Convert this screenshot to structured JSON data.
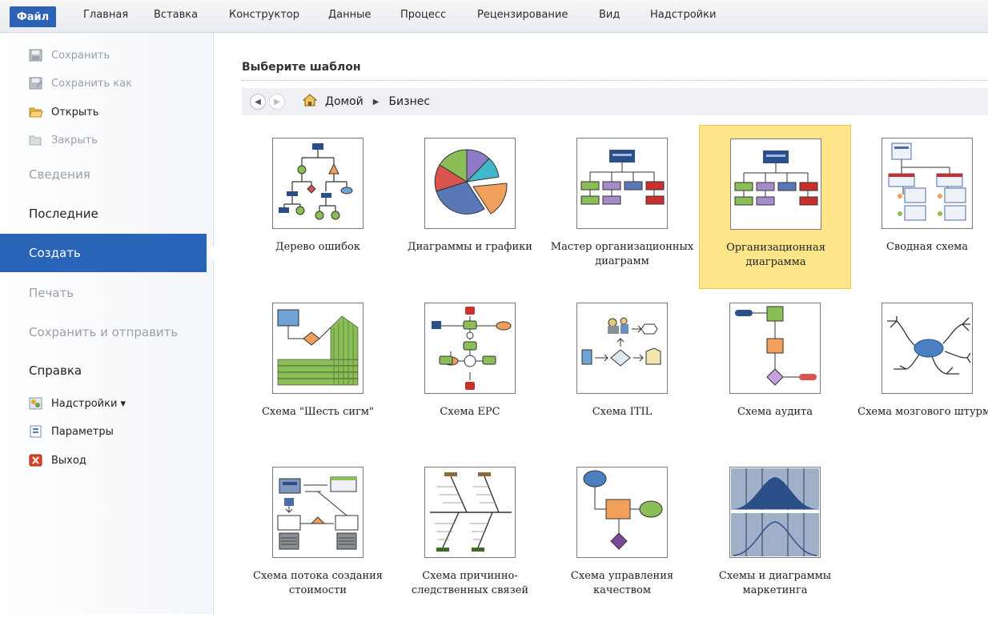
{
  "ribbon": {
    "tabs": [
      "Файл",
      "Главная",
      "Вставка",
      "Конструктор",
      "Данные",
      "Процесс",
      "Рецензирование",
      "Вид",
      "Надстройки"
    ]
  },
  "sidebar": {
    "save": "Сохранить",
    "save_as": "Сохранить как",
    "open": "Открыть",
    "close": "Закрыть",
    "info": "Сведения",
    "recent": "Последние",
    "new": "Создать",
    "print": "Печать",
    "save_send": "Сохранить и отправить",
    "help": "Справка",
    "addins": "Надстройки ▾",
    "options": "Параметры",
    "exit": "Выход"
  },
  "main": {
    "title": "Выберите шаблон",
    "breadcrumb": {
      "home": "Домой",
      "current": "Бизнес"
    },
    "templates": [
      "Дерево ошибок",
      "Диаграммы и графики",
      "Мастер организационных диаграмм",
      "Организационная диаграмма",
      "Сводная схема",
      "Схема \"Шесть сигм\"",
      "Схема EPC",
      "Схема ITIL",
      "Схема аудита",
      "Схема мозгового штурма",
      "Схема потока создания стоимости",
      "Схема причинно-следственных связей",
      "Схема управления качеством",
      "Схемы и диаграммы маркетинга"
    ],
    "selected_index": 3
  }
}
